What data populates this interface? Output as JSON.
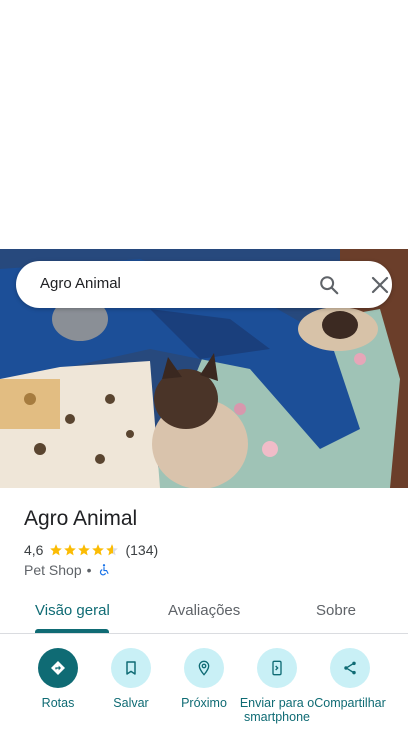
{
  "search": {
    "query": "Agro Animal"
  },
  "place": {
    "name": "Agro Animal",
    "rating": "4,6",
    "stars": 4.6,
    "reviews_count": "(134)",
    "category": "Pet Shop",
    "separator": "•"
  },
  "tabs": [
    {
      "label": "Visão geral",
      "active": true
    },
    {
      "label": "Avaliações",
      "active": false
    },
    {
      "label": "Sobre",
      "active": false
    }
  ],
  "actions": [
    {
      "label": "Rotas",
      "icon": "directions-icon"
    },
    {
      "label": "Salvar",
      "icon": "bookmark-icon"
    },
    {
      "label": "Próximo",
      "icon": "nearby-icon"
    },
    {
      "label": "Enviar para o smartphone",
      "icon": "send-to-phone-icon"
    },
    {
      "label": "Compartilhar",
      "icon": "share-icon"
    }
  ],
  "colors": {
    "accent": "#0f6b74",
    "action_bg": "#c9f0f6",
    "star": "#fbbc04"
  }
}
